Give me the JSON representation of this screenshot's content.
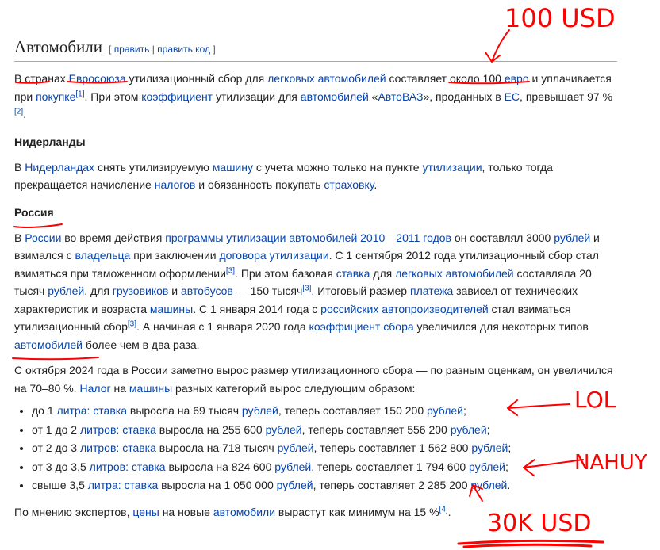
{
  "section": {
    "title": "Автомобили",
    "edit_open": "[",
    "edit": "править",
    "sep": "|",
    "edit_code": "править код",
    "edit_close": "]"
  },
  "p1": {
    "t1": "В ",
    "t2": "странах",
    "t3": " ",
    "l1": "Евросоюза",
    "t4": " утилизационный сбор для ",
    "l2": "легковых автомобилей",
    "t5": " составляет ",
    "t6": "около 100",
    "t7": " ",
    "l3": "евро",
    "t8": " и уплачивается при ",
    "l4": "покупке",
    "s1": "[1]",
    "t9": ". При этом ",
    "l5": "коэффициент",
    "t10": " утилизации для ",
    "l6": "автомобилей",
    "t11": " «",
    "l7": "АвтоВАЗ",
    "t12": "», проданных в ",
    "l8": "ЕС",
    "t13": ", превышает 97 %",
    "s2": "[2]",
    "t14": "."
  },
  "nl": {
    "heading": "Нидерланды",
    "t1": "В ",
    "l1": "Нидерландах",
    "t2": " снять утилизируемую ",
    "l2": "машину",
    "t3": " с учета можно только на пункте ",
    "l3": "утилизации",
    "t4": ", только тогда прекращается начисление ",
    "l4": "налогов",
    "t5": " и обязанность покупать ",
    "l5": "страховку",
    "t6": "."
  },
  "ru": {
    "heading": "Россия",
    "t1": "В ",
    "l1": "России",
    "t2": " во время действия ",
    "l2": "программы утилизации автомобилей 2010—2011 годов",
    "t3": " он составлял 3000 ",
    "l3": "рублей",
    "t4": " и взимался с ",
    "l4": "владельца",
    "t5": " при заключении ",
    "l5": "договора утилизации",
    "t6": ". С 1 сентября 2012 года утилизационный сбор стал взиматься при таможенном оформлении",
    "s1": "[3]",
    "t7": ". При этом базовая ",
    "l6": "ставка",
    "t8": " для ",
    "l7": "легковых автомобилей",
    "t9": " составляла 20 тысяч ",
    "l8": "рублей",
    "t10": ", для ",
    "l9": "грузовиков",
    "t11": " и ",
    "l10": "автобусов",
    "t12": " — 150 тысяч",
    "s2": "[3]",
    "t13": ". Итоговый размер ",
    "l11": "платежа",
    "t14": " зависел от технических характеристик и возраста ",
    "l12": "машины",
    "t15": ". С 1 января 2014 года с ",
    "l13": "российских автопроизводителей",
    "t16": " стал взиматься утилизационный сбор",
    "s3": "[3]",
    "t17": ". А начиная с 1 января 2020 года ",
    "l14": "коэффициент сбора",
    "t18": " увеличился для некоторых типов ",
    "l15": "автомобилей",
    "t19": " более чем в два раза."
  },
  "p3": {
    "t1": "С октября 2024 года в России заметно вырос размер утилизационного сбора — по разным оценкам, он увеличился на 70–80 %. ",
    "l1": "Налог",
    "t2": " на ",
    "l2": "машины",
    "t3": " разных категорий вырос следующим образом:"
  },
  "list": [
    {
      "pre": "до 1 ",
      "unit": "литра",
      "colon": ":",
      "sp": " ",
      "rate": "ставка",
      "mid": " выросла на 69 тысяч ",
      "cur1": "рублей",
      "mid2": ", теперь составляет 150 200 ",
      "cur2": "рублей",
      "end": ";"
    },
    {
      "pre": "от 1 до 2 ",
      "unit": "литров",
      "colon": ":",
      "sp": " ",
      "rate": "ставка",
      "mid": " выросла на 255 600 ",
      "cur1": "рублей",
      "mid2": ", теперь составляет 556 200 ",
      "cur2": "рублей",
      "end": ";"
    },
    {
      "pre": "от 2 до 3 ",
      "unit": "литров",
      "colon": ":",
      "sp": " ",
      "rate": "ставка",
      "mid": " выросла на 718 тысяч ",
      "cur1": "рублей",
      "mid2": ", теперь составляет 1 562 800 ",
      "cur2": "рублей",
      "end": ";"
    },
    {
      "pre": "от 3 до 3,5 ",
      "unit": "литров",
      "colon": ":",
      "sp": " ",
      "rate": "ставка",
      "mid": " выросла на 824 600 ",
      "cur1": "рублей",
      "mid2": ", теперь составляет 1 794 600 ",
      "cur2": "рублей",
      "end": ";"
    },
    {
      "pre": "свыше 3,5 ",
      "unit": "литра",
      "colon": ":",
      "sp": " ",
      "rate": "ставка",
      "mid": " выросла на 1 050 000 ",
      "cur1": "рублей",
      "mid2": ", теперь составляет 2 285 200 ",
      "cur2": "рублей",
      "end": "."
    }
  ],
  "p4": {
    "t1": "По мнению экспертов, ",
    "l1": "цены",
    "t2": " на новые ",
    "l2": "автомобили",
    "t3": " вырастут как минимум на 15 %",
    "s1": "[4]",
    "t4": "."
  },
  "annotations": {
    "top": "100 USD",
    "lol": "LOL",
    "nahuy": "NAHUY",
    "bottom": "30K USD",
    "color": "#ff0000"
  }
}
